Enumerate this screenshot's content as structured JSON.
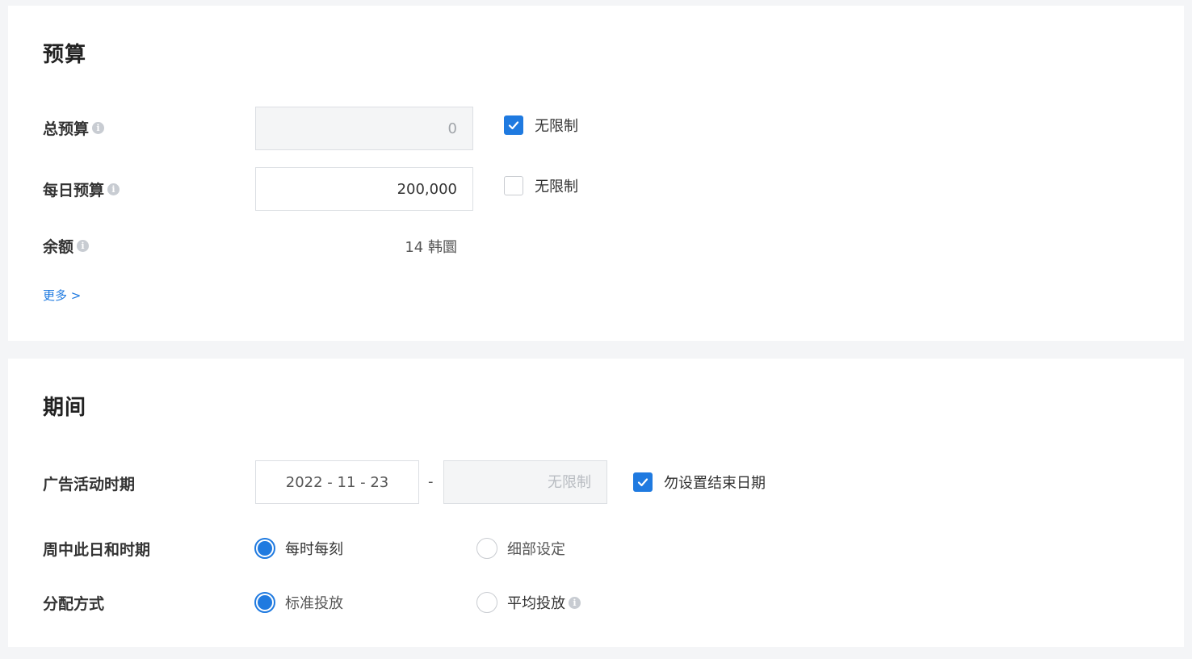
{
  "budget": {
    "title": "预算",
    "total": {
      "label": "总预算",
      "value": "0",
      "unlimited_label": "无限制",
      "unlimited_checked": true
    },
    "daily": {
      "label": "每日预算",
      "value": "200,000",
      "unlimited_label": "无限制",
      "unlimited_checked": false
    },
    "balance": {
      "label": "余额",
      "value": "14 韩圜"
    },
    "more_link": "更多 >"
  },
  "period": {
    "title": "期间",
    "campaign_period": {
      "label": "广告活动时期",
      "start_date": "2022 - 11 - 23",
      "separator": "-",
      "end_placeholder": "无限制",
      "no_end_label": "勿设置结束日期",
      "no_end_checked": true
    },
    "weekday_time": {
      "label": "周中此日和时期",
      "options": [
        {
          "label": "每时每刻",
          "selected": true
        },
        {
          "label": "细部设定",
          "selected": false
        }
      ]
    },
    "delivery": {
      "label": "分配方式",
      "options": [
        {
          "label": "标准投放",
          "selected": true
        },
        {
          "label": "平均投放",
          "selected": false
        }
      ]
    }
  },
  "icons": {
    "info": "info-icon",
    "check": "checkmark-icon"
  },
  "colors": {
    "accent": "#1f7ae0",
    "page_bg": "#f4f5f7",
    "card_bg": "#ffffff",
    "disabled_bg": "#f4f5f6"
  }
}
